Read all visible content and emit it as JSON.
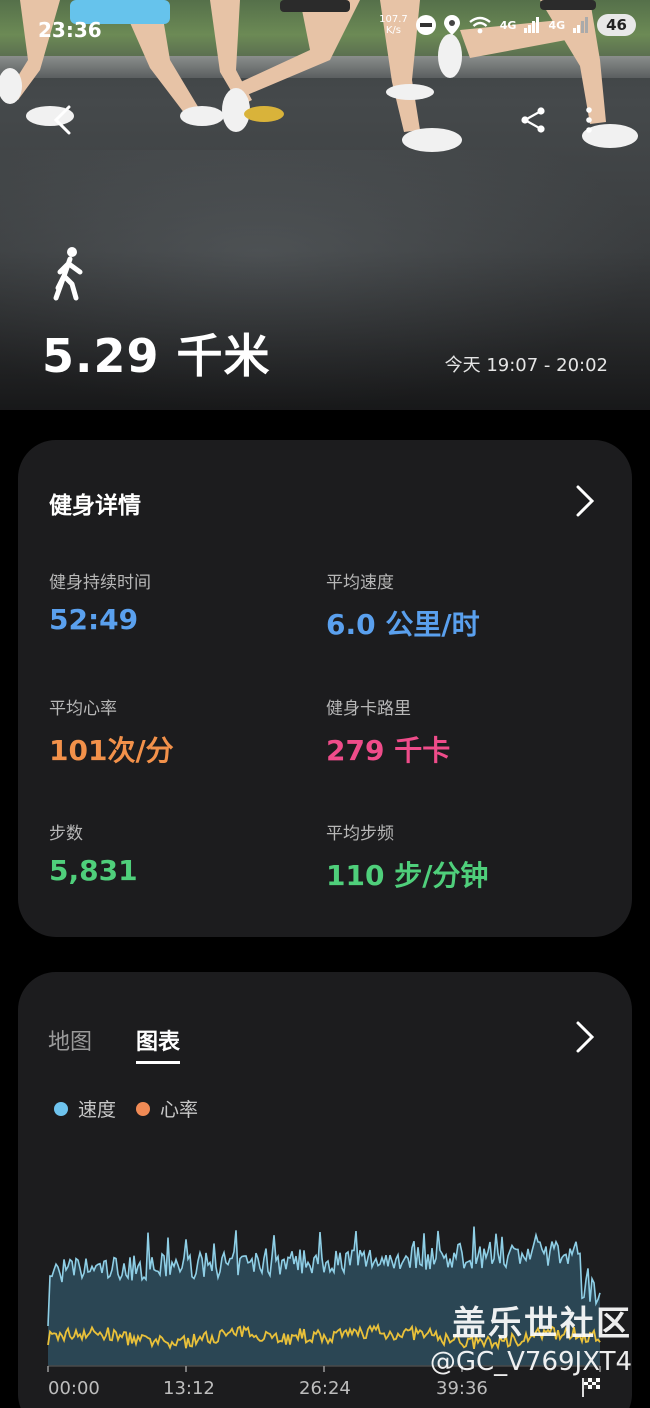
{
  "status_bar": {
    "time": "23:36",
    "net_speed_value": "107.7",
    "net_speed_unit": "K/s",
    "signal1": "4G",
    "signal2": "4G",
    "battery": "46"
  },
  "hero": {
    "distance": "5.29 千米",
    "date_range": "今天 19:07 - 20:02",
    "activity_icon": "walk-icon"
  },
  "details": {
    "title": "健身详情",
    "stats": [
      {
        "label": "健身持续时间",
        "value": "52:49",
        "color": "#5aa0ee"
      },
      {
        "label": "平均速度",
        "value": "6.0 公里/时",
        "color": "#5aa0ee"
      },
      {
        "label": "平均心率",
        "value": "101次/分",
        "color": "#f2914a"
      },
      {
        "label": "健身卡路里",
        "value": "279 千卡",
        "color": "#ef4c8a"
      },
      {
        "label": "步数",
        "value": "5,831",
        "color": "#4fcf7b"
      },
      {
        "label": "平均步频",
        "value": "110 步/分钟",
        "color": "#4fcf7b"
      }
    ]
  },
  "chart_card": {
    "tabs": [
      "地图",
      "图表"
    ],
    "active_tab": "图表",
    "legend": [
      {
        "name": "速度",
        "color": "#6ec3ee"
      },
      {
        "name": "心率",
        "color": "#f08a55"
      }
    ]
  },
  "chart_data": {
    "type": "line",
    "x_tick_labels": [
      "00:00",
      "13:12",
      "26:24",
      "39:36"
    ],
    "series": [
      {
        "name": "速度",
        "color": "#8fcfe6",
        "fill": "#2b4654"
      },
      {
        "name": "心率",
        "color": "#e9c13a"
      }
    ]
  },
  "watermark": {
    "line1": "盖乐世社区",
    "line2": "@GC_V769JXT4"
  }
}
